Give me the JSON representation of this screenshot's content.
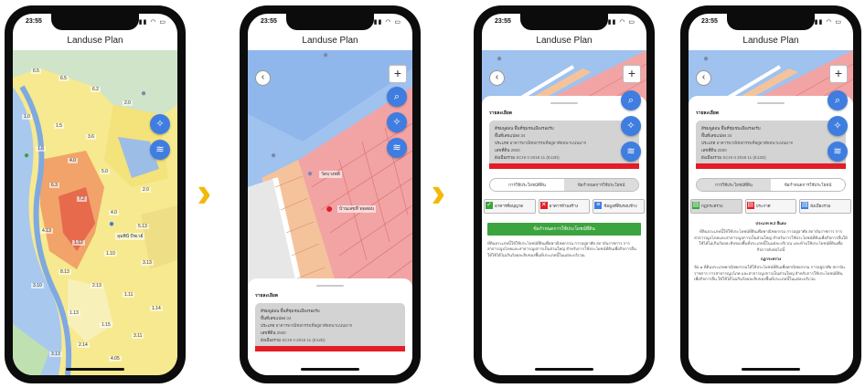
{
  "app": {
    "title": "Landuse Plan",
    "time": "23:55"
  },
  "colors": {
    "accent_blue": "#3f7de0",
    "zone_red": "#f2a4a4",
    "zone_yellow": "#f6e98f",
    "zone_orange": "#f1a36a",
    "highlight_red": "#e21d27",
    "green_button": "#3ca43e",
    "arrow_yellow": "#f3b90a"
  },
  "icons": {
    "search": "search-icon",
    "layers": "layers-icon",
    "compass": "compass-icon",
    "back": "chevron-left-icon",
    "add": "plus-icon"
  },
  "screen1": {
    "far_labels": [
      "6.5",
      "6.5",
      "6.2",
      "2.0",
      "1.0",
      "1.5",
      "3.6",
      "1.6",
      "4.0",
      "5.0",
      "2.0",
      "6.3",
      "7.2",
      "4.0",
      "5.13",
      "4.13",
      "1.12",
      "1.10",
      "3.13",
      "8.13",
      "2.13",
      "1.11",
      "1.14",
      "1.13",
      "1.15",
      "3.10",
      "3.11",
      "2.14",
      "3.13",
      "4.05"
    ],
    "poi_label": "ลุมพินี บีชเวย์"
  },
  "screen2": {
    "poi_label_1": "วัดบางพลี",
    "poi_label_2": "บ้านเลขที่ ทดสอบ",
    "sheet_title": "รายละเอียด",
    "card": {
      "zone_name": "สีชมพูอ่อน พื้นที่ชุมชนเมืองรองรับ",
      "plot_no": "พื้นที่เลขแปลง",
      "plot_val": "34",
      "regulation_label": "ประเภท",
      "regulation_val": "อาคารพาณิชยกรรมที่อยู่อาศัยหนาแน่นมาก",
      "area_label": "เลขที่ดิน",
      "area_val": "2500",
      "code_label": "ผังเมืองรวม",
      "code_val": "SCHI II 2018 11 (E12D)"
    }
  },
  "screen3": {
    "tab_on": "การใช้ประโยชน์ที่ดิน",
    "tab_off": "ข้อกำหนดการใช้ประโยชน์",
    "buttons": [
      "อาคารที่อนุญาต",
      "อาคารห้ามสร้าง",
      "ข้อมูลที่ดินรอบข้าง"
    ],
    "green_button": "ข้อกำหนดการใช้ประโยชน์ที่ดิน",
    "para": "ที่ดินประเภทนี้ให้ใช้ประโยชน์ที่ดินเพื่อพาณิชยกรรม การอยู่อาศัย สถาบันราชการ การสาธารณูปโภคและสาธารณูปการเป็นส่วนใหญ่ สำหรับการใช้ประโยชน์ที่ดินเพื่อกิจการอื่น ให้ใช้ได้ไม่เกินร้อยละสิบของพื้นที่ประเภทนี้ในแต่ละบริเวณ"
  },
  "screen4": {
    "tab_on": "ข้อกำหนดการใช้ประโยชน์",
    "tab_off": "การใช้ประโยชน์ที่ดิน",
    "buttons": [
      "กฎกระทรวง",
      "ประกาศ",
      "ผังเมืองรวม"
    ],
    "heading": "ประเภท พ.3 สีแดง",
    "para1": "ที่ดินประเภทนี้ให้ใช้ประโยชน์ที่ดินเพื่อพาณิชยกรรม การอยู่อาศัย สถาบันราชการ การสาธารณูปโภคและสาธารณูปการเป็นส่วนใหญ่ สำหรับการใช้ประโยชน์ที่ดินเพื่อกิจการอื่นให้ใช้ได้ไม่เกินร้อยละสิบของพื้นที่ประเภทนี้ในแต่ละบริเวณ และห้ามใช้ประโยชน์ที่ดินเพื่อกิจการดังต่อไปนี้",
    "sub_heading": "กฎกระทรวง",
    "para2": "ข้อ ๑ ที่ดินประเภทพาณิชยกรรมให้ใช้ประโยชน์ที่ดินเพื่อพาณิชยกรรม การอยู่อาศัย สถาบันราชการ การสาธารณูปโภค และสาธารณูปการเป็นส่วนใหญ่ สำหรับการใช้ประโยชน์ที่ดินเพื่อกิจการอื่น ให้ใช้ได้ไม่เกินร้อยละสิบของพื้นที่ประเภทนี้ในแต่ละบริเวณ"
  }
}
